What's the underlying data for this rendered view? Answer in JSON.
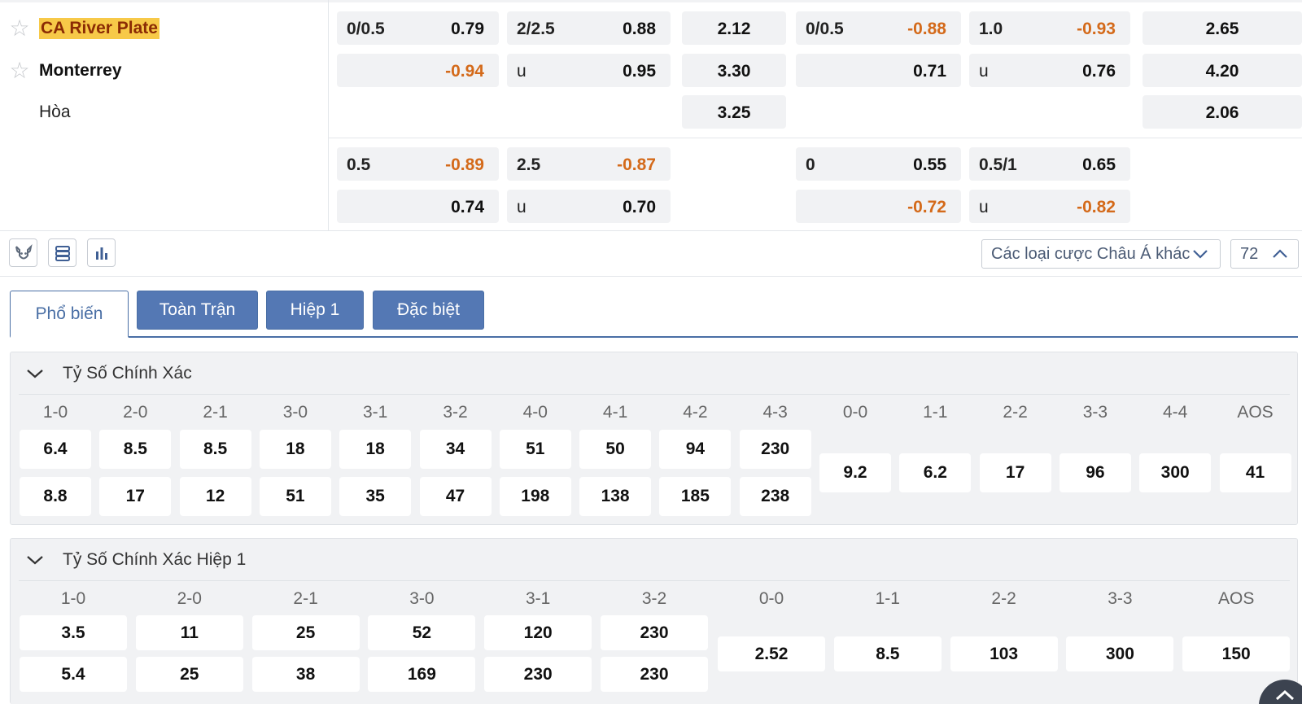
{
  "match": {
    "home": "CA River Plate",
    "away": "Monterrey",
    "draw": "Hòa",
    "main_rows": [
      [
        {
          "label": "0/0.5",
          "value": "0.79"
        },
        {
          "label": "2/2.5",
          "value": "0.88"
        },
        {
          "label": "",
          "value": "2.12"
        },
        {
          "label": "0/0.5",
          "value": "-0.88"
        },
        {
          "label": "1.0",
          "value": "-0.93"
        },
        {
          "label": "",
          "value": "2.65"
        }
      ],
      [
        {
          "label": "",
          "value": "-0.94"
        },
        {
          "label": "u",
          "value": "0.95"
        },
        {
          "label": "",
          "value": "3.30"
        },
        {
          "label": "",
          "value": "0.71"
        },
        {
          "label": "u",
          "value": "0.76"
        },
        {
          "label": "",
          "value": "4.20"
        }
      ],
      [
        {
          "label": "",
          "value": ""
        },
        {
          "label": "",
          "value": ""
        },
        {
          "label": "",
          "value": "3.25"
        },
        {
          "label": "",
          "value": ""
        },
        {
          "label": "",
          "value": ""
        },
        {
          "label": "",
          "value": "2.06"
        }
      ]
    ],
    "alt_rows": [
      [
        {
          "label": "0.5",
          "value": "-0.89"
        },
        {
          "label": "2.5",
          "value": "-0.87"
        },
        {
          "label": "0",
          "value": "0.55"
        },
        {
          "label": "0.5/1",
          "value": "0.65"
        }
      ],
      [
        {
          "label": "",
          "value": "0.74"
        },
        {
          "label": "u",
          "value": "0.70"
        },
        {
          "label": "",
          "value": "-0.72"
        },
        {
          "label": "u",
          "value": "-0.82"
        }
      ]
    ]
  },
  "toolbar": {
    "market_select": "Các loại cược Châu Á khác",
    "count": "72"
  },
  "tabs": [
    "Phổ biến",
    "Toàn Trận",
    "Hiệp 1",
    "Đặc biệt"
  ],
  "correct_score_ft": {
    "title": "Tỷ Số Chính Xác",
    "win_headers": [
      "1-0",
      "2-0",
      "2-1",
      "3-0",
      "3-1",
      "3-2",
      "4-0",
      "4-1",
      "4-2",
      "4-3"
    ],
    "draw_headers": [
      "0-0",
      "1-1",
      "2-2",
      "3-3",
      "4-4",
      "AOS"
    ],
    "home_row": [
      "6.4",
      "8.5",
      "8.5",
      "18",
      "18",
      "34",
      "51",
      "50",
      "94",
      "230"
    ],
    "away_row": [
      "8.8",
      "17",
      "12",
      "51",
      "35",
      "47",
      "198",
      "138",
      "185",
      "238"
    ],
    "draw_row": [
      "9.2",
      "6.2",
      "17",
      "96",
      "300",
      "41"
    ]
  },
  "correct_score_ht": {
    "title": "Tỷ Số Chính Xác Hiệp 1",
    "win_headers": [
      "1-0",
      "2-0",
      "2-1",
      "3-0",
      "3-1",
      "3-2"
    ],
    "draw_headers": [
      "0-0",
      "1-1",
      "2-2",
      "3-3",
      "AOS"
    ],
    "home_row": [
      "3.5",
      "11",
      "25",
      "52",
      "120",
      "230"
    ],
    "away_row": [
      "5.4",
      "25",
      "38",
      "169",
      "230",
      "230"
    ],
    "draw_row": [
      "2.52",
      "8.5",
      "103",
      "300",
      "150"
    ]
  },
  "colors": {
    "negative": "#d46a1a",
    "highlight": "#f7c948",
    "tab_blue": "#5478b4",
    "cell_bg": "#f1f2f4"
  },
  "icons": [
    "bull-icon",
    "layers-icon",
    "bar-chart-icon",
    "chevron-down-icon",
    "chevron-up-icon",
    "star-icon"
  ]
}
